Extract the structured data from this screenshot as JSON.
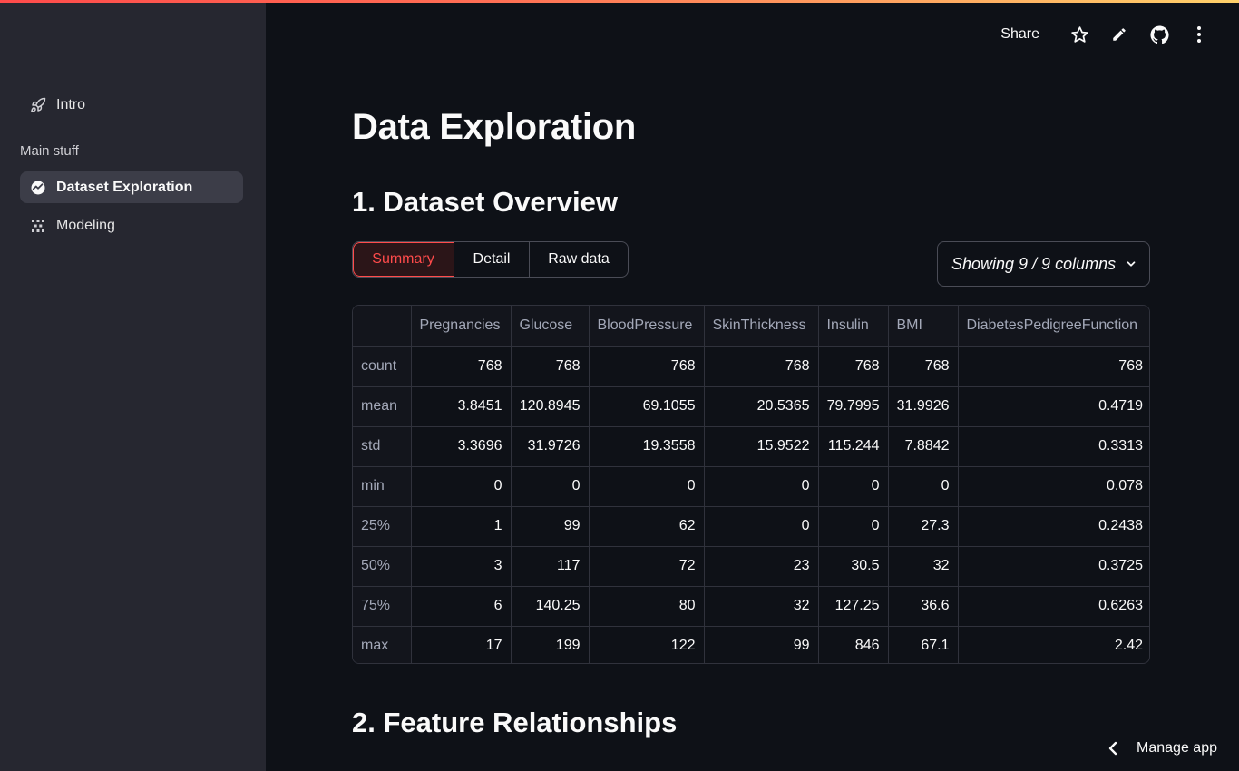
{
  "sidebar": {
    "items": [
      {
        "label": "Intro",
        "icon": "rocket-icon"
      },
      {
        "label": "Dataset Exploration",
        "icon": "chart-circle-icon",
        "active": true
      },
      {
        "label": "Modeling",
        "icon": "grid-dots-icon"
      }
    ],
    "section_label": "Main stuff"
  },
  "header": {
    "share_label": "Share"
  },
  "main": {
    "title": "Data Exploration",
    "section1_title": "1. Dataset Overview",
    "section2_title": "2. Feature Relationships",
    "tabs": [
      "Summary",
      "Detail",
      "Raw data"
    ],
    "active_tab": "Summary",
    "column_selector": "Showing 9 / 9 columns"
  },
  "table": {
    "columns": [
      "",
      "Pregnancies",
      "Glucose",
      "BloodPressure",
      "SkinThickness",
      "Insulin",
      "BMI",
      "DiabetesPedigreeFunction"
    ],
    "rows": [
      [
        "count",
        "768",
        "768",
        "768",
        "768",
        "768",
        "768",
        "768"
      ],
      [
        "mean",
        "3.8451",
        "120.8945",
        "69.1055",
        "20.5365",
        "79.7995",
        "31.9926",
        "0.4719"
      ],
      [
        "std",
        "3.3696",
        "31.9726",
        "19.3558",
        "15.9522",
        "115.244",
        "7.8842",
        "0.3313"
      ],
      [
        "min",
        "0",
        "0",
        "0",
        "0",
        "0",
        "0",
        "0.078"
      ],
      [
        "25%",
        "1",
        "99",
        "62",
        "0",
        "0",
        "27.3",
        "0.2438"
      ],
      [
        "50%",
        "3",
        "117",
        "72",
        "23",
        "30.5",
        "32",
        "0.3725"
      ],
      [
        "75%",
        "6",
        "140.25",
        "80",
        "32",
        "127.25",
        "36.6",
        "0.6263"
      ],
      [
        "max",
        "17",
        "199",
        "122",
        "99",
        "846",
        "67.1",
        "2.42"
      ]
    ]
  },
  "footer": {
    "manage_label": "Manage app"
  },
  "colors": {
    "accent": "#ff4b4b",
    "background": "#0e1117",
    "sidebar": "#262730"
  }
}
